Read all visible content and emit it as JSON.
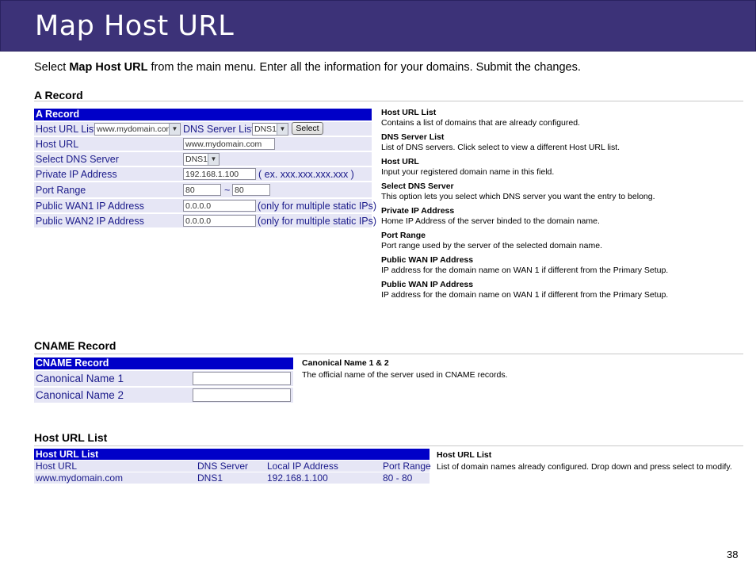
{
  "header": {
    "title": "Map Host URL"
  },
  "intro": {
    "pre": "Select ",
    "bold": "Map Host URL",
    "post": " from the main menu. Enter all the information for your domains. Submit the changes."
  },
  "a_record": {
    "section_title": "A Record",
    "form_title": "A Record",
    "host_url_list_label": "Host URL List",
    "host_url_list_value": "www.mydomain.com",
    "dns_server_list_label": "DNS Server List",
    "dns_server_list_value": "DNS1",
    "select_button": "Select",
    "host_url_label": "Host URL",
    "host_url_value": "www.mydomain.com",
    "select_dns_label": "Select DNS Server",
    "select_dns_value": "DNS1",
    "private_ip_label": "Private IP Address",
    "private_ip_value": "192.168.1.100",
    "private_ip_hint": "( ex. xxx.xxx.xxx.xxx )",
    "port_range_label": "Port Range",
    "port_from": "80",
    "port_sep": "~",
    "port_to": "80",
    "wan1_label": "Public WAN1 IP Address",
    "wan1_value": "0.0.0.0",
    "wan1_hint": "(only for multiple static IPs)",
    "wan2_label": "Public WAN2 IP Address",
    "wan2_value": "0.0.0.0",
    "wan2_hint": "(only for multiple static IPs)",
    "descriptions": [
      {
        "term": "Host URL List",
        "text": "Contains a list of domains that are already configured."
      },
      {
        "term": "DNS Server List",
        "text": "List of DNS servers.  Click select to view a different Host URL list."
      },
      {
        "term": "Host URL",
        "text": "Input your registered domain name in this field."
      },
      {
        "term": "Select DNS Server",
        "text": "This option lets you select which DNS server you want the entry to belong."
      },
      {
        "term": "Private IP Address",
        "text": "Home IP Address of the server binded to the domain name."
      },
      {
        "term": "Port Range",
        "text": "Port range used by the server of the selected domain name."
      },
      {
        "term": "Public WAN IP Address",
        "text": "IP address for the domain name on WAN 1 if different  from the Primary Setup."
      },
      {
        "term": "Public WAN IP Address",
        "text": "IP address for the domain name on WAN 1 if different  from the Primary Setup."
      }
    ]
  },
  "cname": {
    "section_title": "CNAME Record",
    "form_title": "CNAME Record",
    "name1_label": "Canonical Name 1",
    "name1_value": "",
    "name2_label": "Canonical Name 2",
    "name2_value": "",
    "desc_term": "Canonical Name 1 & 2",
    "desc_text": "The official name of the server used in CNAME records."
  },
  "host_list": {
    "section_title": "Host URL List",
    "table_title": "Host URL List",
    "headers": [
      "Host URL",
      "DNS Server",
      "Local IP Address",
      "Port Range"
    ],
    "rows": [
      [
        "www.mydomain.com",
        "DNS1",
        "192.168.1.100",
        "80 - 80"
      ]
    ],
    "desc_term": "Host URL List",
    "desc_text": "List of domain names already configured.  Drop down and press select to modify."
  },
  "page_number": "38",
  "colors": {
    "header_bg": "#3c3278",
    "form_bar": "#0000c8",
    "row_bg": "#e6e6f5",
    "label_text": "#1a1a8a"
  }
}
